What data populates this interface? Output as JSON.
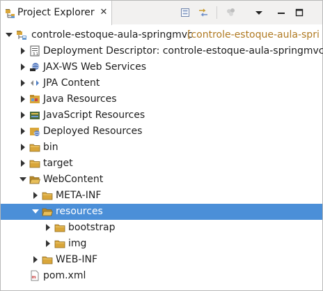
{
  "window": {
    "tab_title": "Project Explorer",
    "tab_close_symbol": "✕",
    "tab_icon": "project-explorer-icon"
  },
  "toolbar": {
    "collapse_all": "collapse-all-icon",
    "link_with_editor": "link-with-editor-icon",
    "filters": "filters-icon",
    "view_menu": "view-menu-icon",
    "minimize": "minimize-icon",
    "maximize": "maximize-icon"
  },
  "tree": {
    "project": {
      "name": "controle-estoque-aula-springmvc",
      "decoration": "[controle-estoque-aula-spri"
    },
    "items": [
      {
        "label": "Deployment Descriptor: controle-estoque-aula-springmvc",
        "icon": "deployment-descriptor-icon"
      },
      {
        "label": "JAX-WS Web Services",
        "icon": "web-services-icon"
      },
      {
        "label": "JPA Content",
        "icon": "jpa-icon"
      },
      {
        "label": "Java Resources",
        "icon": "java-resources-icon"
      },
      {
        "label": "JavaScript Resources",
        "icon": "javascript-resources-icon"
      },
      {
        "label": "Deployed Resources",
        "icon": "deployed-resources-icon"
      },
      {
        "label": "bin",
        "icon": "folder-icon"
      },
      {
        "label": "target",
        "icon": "folder-icon"
      },
      {
        "label": "WebContent",
        "icon": "open-folder-icon"
      },
      {
        "label": "META-INF",
        "icon": "folder-icon"
      },
      {
        "label": "resources",
        "icon": "open-folder-icon"
      },
      {
        "label": "bootstrap",
        "icon": "folder-icon"
      },
      {
        "label": "img",
        "icon": "folder-icon"
      },
      {
        "label": "WEB-INF",
        "icon": "folder-icon"
      },
      {
        "label": "pom.xml",
        "icon": "xml-file-icon"
      }
    ]
  },
  "colors": {
    "selection": "#4b8fd8",
    "decoration": "#b07a22",
    "folder": "#d9a63a"
  }
}
